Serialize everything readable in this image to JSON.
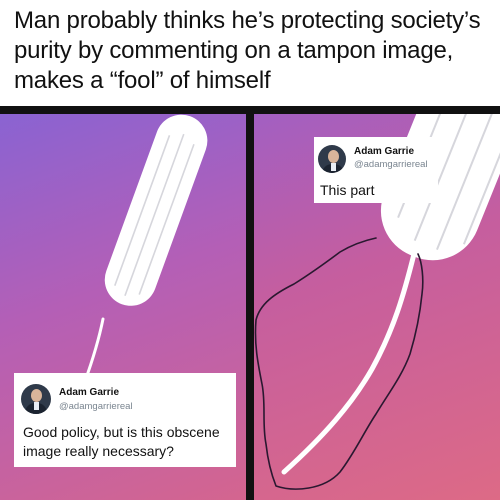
{
  "headline": "Man probably thinks he’s protecting society’s purity by commenting on a tampon image, makes a “fool” of himself",
  "left_panel": {
    "background": [
      "#8a63d2",
      "#d4658f"
    ],
    "tweet": {
      "author_name": "Adam Garrie",
      "author_handle": "@adamgarriereal",
      "text": "Good policy, but is this obscene image really necessary?"
    }
  },
  "right_panel": {
    "background": [
      "#a25fc2",
      "#dd6a86"
    ],
    "tweet": {
      "author_name": "Adam Garrie",
      "author_handle": "@adamgarriereal",
      "text": "This part"
    }
  },
  "icons": [
    "tampon-illustration",
    "avatar-photo",
    "hand-drawn-outline"
  ],
  "colors": {
    "divider": "#111111",
    "card": "#ffffff",
    "handle": "#7a8590"
  }
}
